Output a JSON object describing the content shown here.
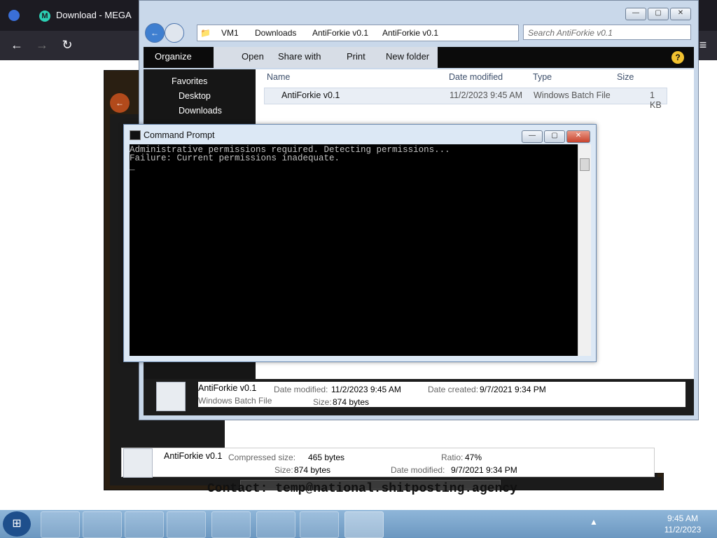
{
  "browser": {
    "tab_title": "Download - MEGA",
    "tab_icon": "mega-icon"
  },
  "archive": {
    "status": {
      "name": "AntiForkie v0.1",
      "compressed_label": "Compressed size:",
      "compressed_value": "465 bytes",
      "size_label": "Size:",
      "size_value": "874 bytes",
      "ratio_label": "Ratio:",
      "ratio_value": "47%",
      "modified_label": "Date modified:",
      "modified_value": "9/7/2021 9:34 PM"
    }
  },
  "explorer": {
    "breadcrumb": [
      "VM1",
      "Downloads",
      "AntiForkie v0.1",
      "AntiForkie v0.1"
    ],
    "search_placeholder": "Search AntiForkie v0.1",
    "toolbar": {
      "organize": "Organize",
      "open": "Open",
      "share": "Share with",
      "print": "Print",
      "new_folder": "New folder"
    },
    "sidebar": {
      "favorites": "Favorites",
      "desktop": "Desktop",
      "downloads": "Downloads"
    },
    "columns": {
      "name": "Name",
      "date": "Date modified",
      "type": "Type",
      "size": "Size"
    },
    "rows": [
      {
        "name": "AntiForkie v0.1",
        "date": "11/2/2023 9:45 AM",
        "type": "Windows Batch File",
        "size": "1 KB"
      }
    ],
    "details": {
      "name": "AntiForkie v0.1",
      "type": "Windows Batch File",
      "modified_label": "Date modified:",
      "modified_value": "11/2/2023 9:45 AM",
      "created_label": "Date created:",
      "created_value": "9/7/2021 9:34 PM",
      "size_label": "Size:",
      "size_value": "874 bytes"
    }
  },
  "cmd": {
    "title": "Command Prompt",
    "line1": "Administrative permissions required. Detecting permissions...",
    "line2": "Failure: Current permissions inadequate.",
    "cursor": "_"
  },
  "page_footer": {
    "contact": "Contact: temp@national.shitposting.agency"
  },
  "taskbar": {
    "time": "9:45 AM",
    "date": "11/2/2023"
  },
  "colors": {
    "taskbar": "#7aa6cf",
    "console_bg": "#000000",
    "console_fg": "#c0c0c0"
  }
}
